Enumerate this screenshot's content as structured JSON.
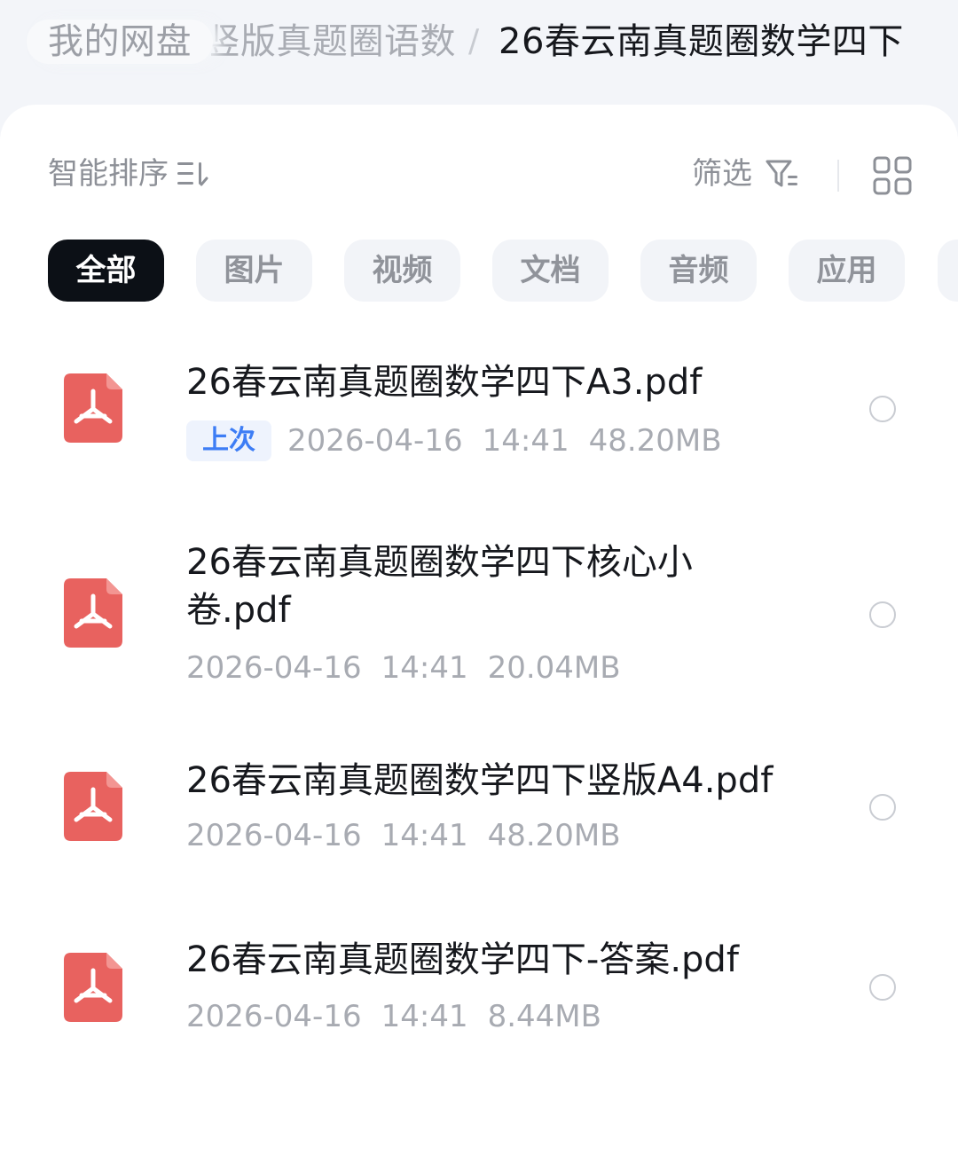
{
  "breadcrumb": {
    "root": "我的网盘",
    "middle": "竖版真题圈语数",
    "separator": "/",
    "current": "26春云南真题圈数学四下"
  },
  "toolbar": {
    "sort_label": "智能排序",
    "sort_icon": "sort-lines-icon",
    "filter_label": "筛选",
    "filter_icon": "filter-funnel-icon",
    "view_icon": "grid-view-icon"
  },
  "categories": [
    {
      "label": "全部",
      "active": true
    },
    {
      "label": "图片",
      "active": false
    },
    {
      "label": "视频",
      "active": false
    },
    {
      "label": "文档",
      "active": false
    },
    {
      "label": "音频",
      "active": false
    },
    {
      "label": "应用",
      "active": false
    }
  ],
  "files": [
    {
      "name": "26春云南真题圈数学四下A3.pdf",
      "badge": "上次",
      "date": "2026-04-16",
      "time": "14:41",
      "size": "48.20MB"
    },
    {
      "name": "26春云南真题圈数学四下核心小卷.pdf",
      "badge": "",
      "date": "2026-04-16",
      "time": "14:41",
      "size": "20.04MB"
    },
    {
      "name": "26春云南真题圈数学四下竖版A4.pdf",
      "badge": "",
      "date": "2026-04-16",
      "time": "14:41",
      "size": "48.20MB"
    },
    {
      "name": "26春云南真题圈数学四下-答案.pdf",
      "badge": "",
      "date": "2026-04-16",
      "time": "14:41",
      "size": "8.44MB"
    }
  ],
  "colors": {
    "accent": "#3d7df5",
    "pdf_icon": "#e8625f",
    "active_pill": "#0c1016"
  }
}
